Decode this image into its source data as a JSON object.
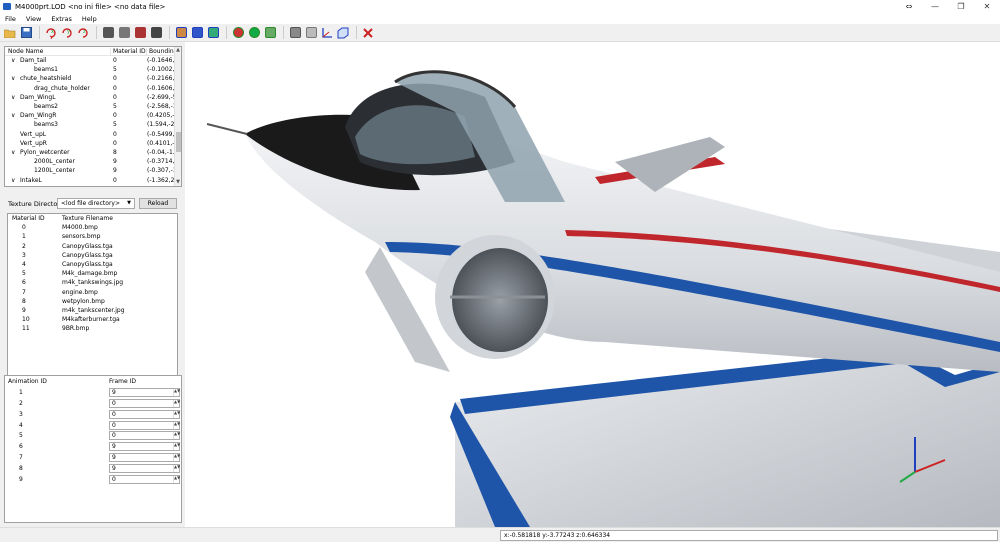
{
  "window": {
    "title": "M4000prt.LOD  <no ini file>  <no data file>",
    "controls": [
      "⇔",
      "—",
      "❐",
      "✕"
    ]
  },
  "menu": [
    "File",
    "View",
    "Extras",
    "Help"
  ],
  "toolbar": {
    "icons": [
      "open-folder-icon",
      "save-icon",
      "rotate-x-icon",
      "rotate-y-icon",
      "rotate-z-icon",
      "solid-box-icon",
      "solid-box-gray-icon",
      "solid-box-red-icon",
      "box-select-icon",
      "wireframe-icon",
      "wire-blue-icon",
      "texture-green-icon",
      "shade-red-icon",
      "shade-dark-icon",
      "shade-green-icon",
      "cube-gray-icon",
      "cube-outline-icon",
      "axes-icon",
      "cube-blue-icon",
      "tools-icon"
    ]
  },
  "tree": {
    "headers": [
      "Node Name",
      "Material ID",
      "Bounding"
    ],
    "rows": [
      {
        "name": "Dam_tail",
        "mat": "0",
        "bb": "(-0.1646,-",
        "level": 1,
        "expand": "∨"
      },
      {
        "name": "beams1",
        "mat": "5",
        "bb": "(-0.1002,-",
        "level": 2,
        "expand": ""
      },
      {
        "name": "chute_heatshield",
        "mat": "0",
        "bb": "(-0.2166,-",
        "level": 1,
        "expand": "∨"
      },
      {
        "name": "drag_chute_holder",
        "mat": "0",
        "bb": "(-0.1606,-",
        "level": 2,
        "expand": ""
      },
      {
        "name": "Dam_WingL",
        "mat": "0",
        "bb": "(-2.699,-5",
        "level": 1,
        "expand": "∨"
      },
      {
        "name": "beams2",
        "mat": "5",
        "bb": "(-2.568,-1",
        "level": 2,
        "expand": ""
      },
      {
        "name": "Dam_WingR",
        "mat": "0",
        "bb": "(0.4205,-5",
        "level": 1,
        "expand": "∨"
      },
      {
        "name": "beams3",
        "mat": "5",
        "bb": "(1.594,-2.",
        "level": 2,
        "expand": ""
      },
      {
        "name": "Vert_upL",
        "mat": "0",
        "bb": "(-0.5499,-",
        "level": 1,
        "expand": ""
      },
      {
        "name": "Vert_upR",
        "mat": "0",
        "bb": "(0.4101,-1",
        "level": 1,
        "expand": ""
      },
      {
        "name": "Pylon_wetcenter",
        "mat": "8",
        "bb": "(-0.04,-1.:",
        "level": 1,
        "expand": "∨"
      },
      {
        "name": "2000L_center",
        "mat": "9",
        "bb": "(-0.3714,-",
        "level": 2,
        "expand": ""
      },
      {
        "name": "1200L_center",
        "mat": "9",
        "bb": "(-0.307,-1",
        "level": 2,
        "expand": ""
      },
      {
        "name": "IntakeL",
        "mat": "0",
        "bb": "(-1.362,2.",
        "level": 1,
        "expand": "∨"
      }
    ]
  },
  "texture_dir": {
    "label": "Texture Directory:",
    "value": "<lod file directory>",
    "reload": "Reload"
  },
  "textures": {
    "headers": [
      "Material ID",
      "Texture Filename"
    ],
    "rows": [
      [
        "0",
        "M4000.bmp"
      ],
      [
        "1",
        "sensors.bmp"
      ],
      [
        "2",
        "CanopyGlass.tga"
      ],
      [
        "3",
        "CanopyGlass.tga"
      ],
      [
        "4",
        "CanopyGlass.tga"
      ],
      [
        "5",
        "M4k_damage.bmp"
      ],
      [
        "6",
        "m4k_tankswings.jpg"
      ],
      [
        "7",
        "engine.bmp"
      ],
      [
        "8",
        "wetpylon.bmp"
      ],
      [
        "9",
        "m4k_tankscenter.jpg"
      ],
      [
        "10",
        "M4kafterburner.tga"
      ],
      [
        "11",
        "9BR.bmp"
      ]
    ]
  },
  "animation": {
    "headers": [
      "Animation ID",
      "Frame ID"
    ],
    "rows": [
      [
        "1",
        "9"
      ],
      [
        "2",
        "0"
      ],
      [
        "3",
        "0"
      ],
      [
        "4",
        "0"
      ],
      [
        "5",
        "0"
      ],
      [
        "6",
        "9"
      ],
      [
        "7",
        "9"
      ],
      [
        "8",
        "9"
      ],
      [
        "9",
        "0"
      ]
    ]
  },
  "status": {
    "coords": "x:-0.581818 y:-3.77243 z:0.646334"
  },
  "colors": {
    "jet_body": "#e3e5e8",
    "nose": "#1a1a1a",
    "stripe_blue": "#1f55a8",
    "stripe_red": "#c0272d"
  }
}
